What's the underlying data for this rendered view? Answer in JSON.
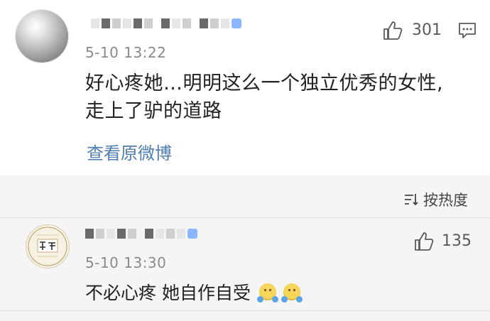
{
  "comment1": {
    "timestamp": "5-10 13:22",
    "like_count": "301",
    "text_line1": "好心疼她…明明这么一个独立优秀的女性,",
    "text_line2": "走上了驴的道路",
    "link_text": "查看原微博",
    "icons": [
      "thumbs-up-icon",
      "comment-icon"
    ]
  },
  "sort_bar": {
    "label": "按热度",
    "icon": "sort-icon"
  },
  "comment2": {
    "timestamp": "5-10 13:30",
    "like_count": "135",
    "text": "不必心疼 她自作自受",
    "emojis": [
      "hug-emoji",
      "hug-emoji"
    ],
    "icons": [
      "thumbs-up-icon"
    ]
  },
  "colors": {
    "link": "#507daf",
    "timestamp": "#8a8a8a",
    "band": "#f5f5f5"
  }
}
